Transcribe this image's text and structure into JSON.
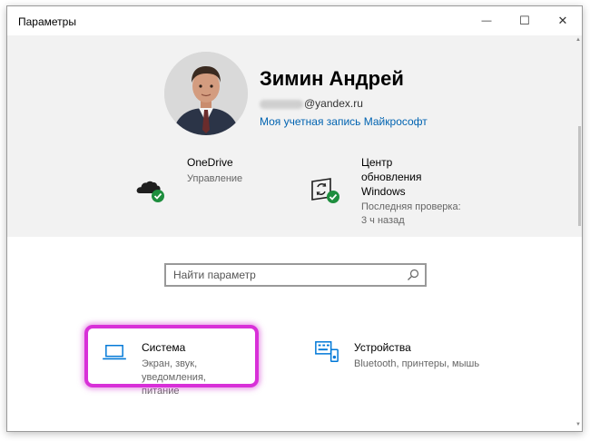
{
  "window": {
    "title": "Параметры",
    "controls": {
      "minimize": "—",
      "maximize": "☐",
      "close": "✕"
    }
  },
  "account": {
    "name": "Зимин Андрей",
    "email_visible": "@yandex.ru",
    "link_label": "Моя учетная запись Майкрософт"
  },
  "status_tiles": [
    {
      "title": "OneDrive",
      "subtitle": "Управление",
      "icon": "onedrive-cloud-icon",
      "status_icon": "check-badge-icon"
    },
    {
      "title": "Центр\nобновления\nWindows",
      "subtitle": "Последняя проверка:\n3 ч назад",
      "icon": "windows-update-icon",
      "status_icon": "check-badge-icon"
    }
  ],
  "search": {
    "placeholder": "Найти параметр",
    "icon": "search-icon"
  },
  "categories": [
    {
      "title": "Система",
      "description": "Экран, звук, уведомления,\nпитание",
      "icon": "laptop-icon"
    },
    {
      "title": "Устройства",
      "description": "Bluetooth, принтеры, мышь",
      "icon": "devices-icon"
    }
  ],
  "colors": {
    "accent": "#0063b1",
    "icon_blue": "#0078d7",
    "status_green": "#1e8e3e",
    "highlight": "#d830d8",
    "hero_bg": "#f2f2f2"
  }
}
